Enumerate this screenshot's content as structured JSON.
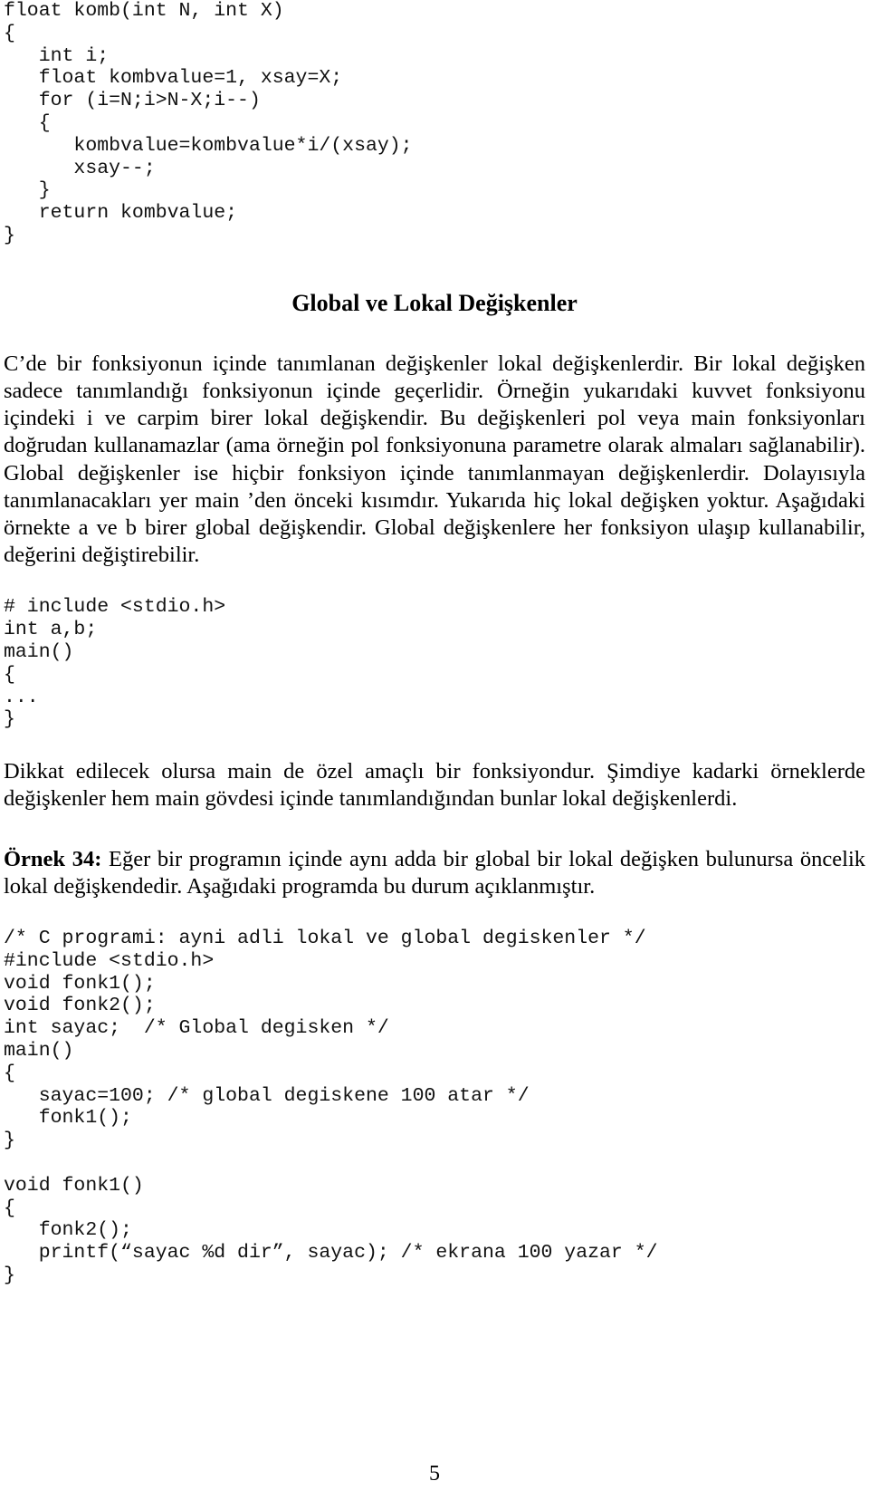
{
  "document": {
    "language": "tr",
    "page_number": "5",
    "text_color": "#000000",
    "background_color": "#ffffff"
  },
  "code_block_1": {
    "name": "komb-function-code",
    "lines": [
      "float komb(int N, int X)",
      "{",
      "   int i;",
      "   float kombvalue=1, xsay=X;",
      "   for (i=N;i>N-X;i--)",
      "   {",
      "      kombvalue=kombvalue*i/(xsay);",
      "      xsay--;",
      "   }",
      "   return kombvalue;",
      "}"
    ]
  },
  "heading_1": {
    "text": "Global ve Lokal Değişkenler"
  },
  "paragraph_1": {
    "text": "C’de bir fonksiyonun içinde tanımlanan değişkenler lokal değişkenlerdir. Bir lokal değişken sadece tanımlandığı fonksiyonun içinde geçerlidir. Örneğin yukarıdaki kuvvet fonksiyonu içindeki i ve carpim birer lokal değişkendir. Bu değişkenleri pol veya main fonksiyonları doğrudan kullanamazlar (ama örneğin pol fonksiyonuna parametre olarak almaları sağlanabilir). Global değişkenler ise hiçbir fonksiyon içinde tanımlanmayan değişkenlerdir. Dolayısıyla tanımlanacakları yer main ’den önceki kısımdır. Yukarıda hiç lokal değişken yoktur. Aşağıdaki örnekte a ve b birer global değişkendir. Global değişkenlere her fonksiyon ulaşıp kullanabilir, değerini değiştirebilir."
  },
  "code_block_2": {
    "name": "global-variables-skeleton-code",
    "lines": [
      "# include <stdio.h>",
      "int a,b;",
      "main()",
      "{",
      "...",
      "}"
    ]
  },
  "paragraph_2": {
    "text": "Dikkat edilecek olursa main de özel amaçlı bir fonksiyondur. Şimdiye kadarki örneklerde değişkenler hem main gövdesi içinde tanımlandığından bunlar lokal değişkenlerdi."
  },
  "paragraph_3": {
    "label": "Örnek 34:",
    "text": " Eğer bir programın içinde aynı adda bir global bir lokal değişken bulunursa öncelik lokal değişkendedir. Aşağıdaki programda bu durum açıklanmıştır."
  },
  "code_block_3": {
    "name": "sayac-global-local-example-code",
    "lines": [
      "/* C programi: ayni adli lokal ve global degiskenler */",
      "#include <stdio.h>",
      "void fonk1();",
      "void fonk2();",
      "int sayac;  /* Global degisken */",
      "main()",
      "{",
      "   sayac=100; /* global degiskene 100 atar */",
      "   fonk1();",
      "}",
      "",
      "void fonk1()",
      "{",
      "   fonk2();",
      "   printf(“sayac %d dir”, sayac); /* ekrana 100 yazar */",
      "}"
    ]
  }
}
